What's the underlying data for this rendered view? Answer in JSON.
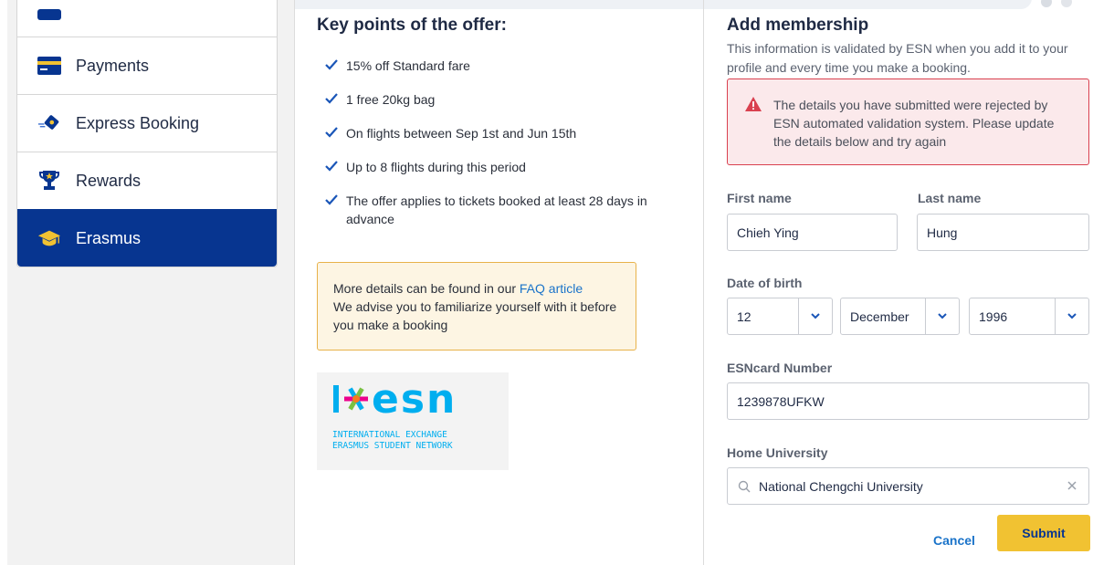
{
  "sidebar": {
    "items": [
      {
        "label": "",
        "icon": "wallet-icon"
      },
      {
        "label": "Payments",
        "icon": "credit-card-icon"
      },
      {
        "label": "Express Booking",
        "icon": "plane-ticket-icon"
      },
      {
        "label": "Rewards",
        "icon": "trophy-icon"
      },
      {
        "label": "Erasmus",
        "icon": "graduation-cap-icon",
        "active": true
      }
    ]
  },
  "offer": {
    "title": "Key points of the offer:",
    "points": [
      "15% off Standard fare",
      "1 free 20kg bag",
      "On flights between Sep 1st and Jun 15th",
      "Up to 8 flights during this period",
      "The offer applies to tickets booked at least 28 days in advance"
    ],
    "info_prefix": "More details can be found in our ",
    "info_link": "FAQ article",
    "info_rest": "We advise you to familiarize yourself with it before you make a booking",
    "logo": {
      "wordmark": "esn",
      "line1": "INTERNATIONAL EXCHANGE",
      "line2": "ERASMUS STUDENT NETWORK"
    }
  },
  "membership": {
    "title": "Add membership",
    "subtitle": "This information is validated by ESN when you add it to your profile and every time you make a booking.",
    "error": "The details you have submitted were rejected by ESN automated validation system. Please update the details below and try again",
    "first_name_label": "First name",
    "first_name_value": "Chieh Ying",
    "last_name_label": "Last name",
    "last_name_value": "Hung",
    "dob_label": "Date of birth",
    "dob_day": "12",
    "dob_month": "December",
    "dob_year": "1996",
    "esncard_label": "ESNcard Number",
    "esncard_value": "1239878UFKW",
    "university_label": "Home University",
    "university_value": "National Chengchi University",
    "cancel_label": "Cancel",
    "submit_label": "Submit"
  },
  "colors": {
    "brand_blue": "#073590",
    "link_blue": "#1a73c9",
    "submit_yellow": "#f1c232",
    "error_red": "#d9404f",
    "esn_cyan": "#00aeef",
    "esn_magenta": "#ec008c",
    "esn_green": "#7ac143",
    "esn_orange": "#f47b20"
  }
}
